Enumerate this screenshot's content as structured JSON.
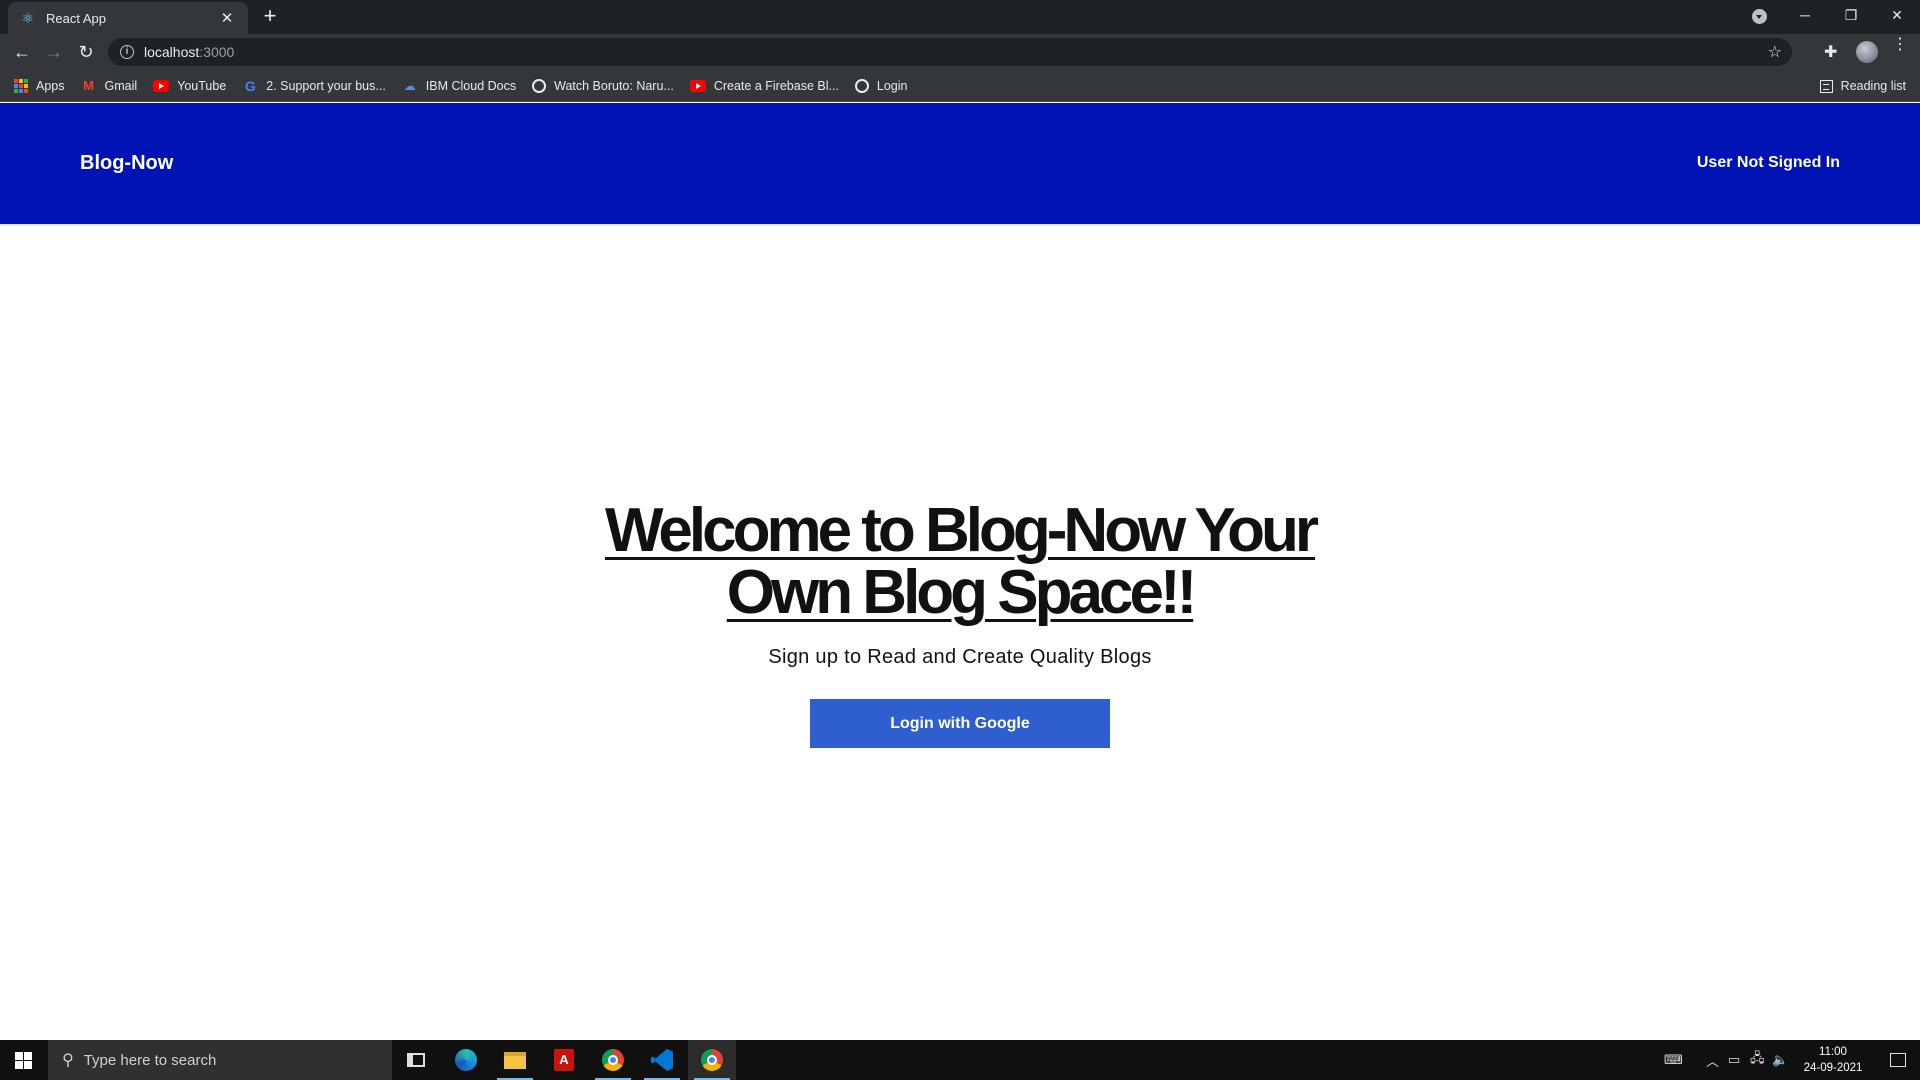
{
  "browser": {
    "tab": {
      "title": "React App",
      "favicon": "react-icon"
    },
    "address": {
      "host": "localhost",
      "port": ":3000"
    },
    "bookmarks": [
      {
        "label": "Apps",
        "icon": "apps-grid-icon"
      },
      {
        "label": "Gmail",
        "icon": "gmail-icon"
      },
      {
        "label": "YouTube",
        "icon": "youtube-icon"
      },
      {
        "label": "2. Support your bus...",
        "icon": "google-icon"
      },
      {
        "label": "IBM Cloud Docs",
        "icon": "ibm-icon"
      },
      {
        "label": "Watch Boruto: Naru...",
        "icon": "globe-icon"
      },
      {
        "label": "Create a Firebase Bl...",
        "icon": "youtube-icon"
      },
      {
        "label": "Login",
        "icon": "globe-icon"
      }
    ],
    "reading_list": "Reading list"
  },
  "header": {
    "brand": "Blog-Now",
    "auth_status": "User Not Signed In",
    "background": "#0013b4"
  },
  "hero": {
    "title": "Welcome to Blog-Now Your Own Blog Space!!",
    "subtitle": "Sign up to Read and Create Quality Blogs",
    "login_button": "Login with Google",
    "button_color": "#2f5ecf"
  },
  "taskbar": {
    "search_placeholder": "Type here to search",
    "apps": [
      "task-view",
      "edge",
      "file-explorer",
      "acrobat",
      "chrome",
      "vscode",
      "chrome"
    ],
    "clock": {
      "time": "11:00",
      "date": "24-09-2021"
    }
  }
}
